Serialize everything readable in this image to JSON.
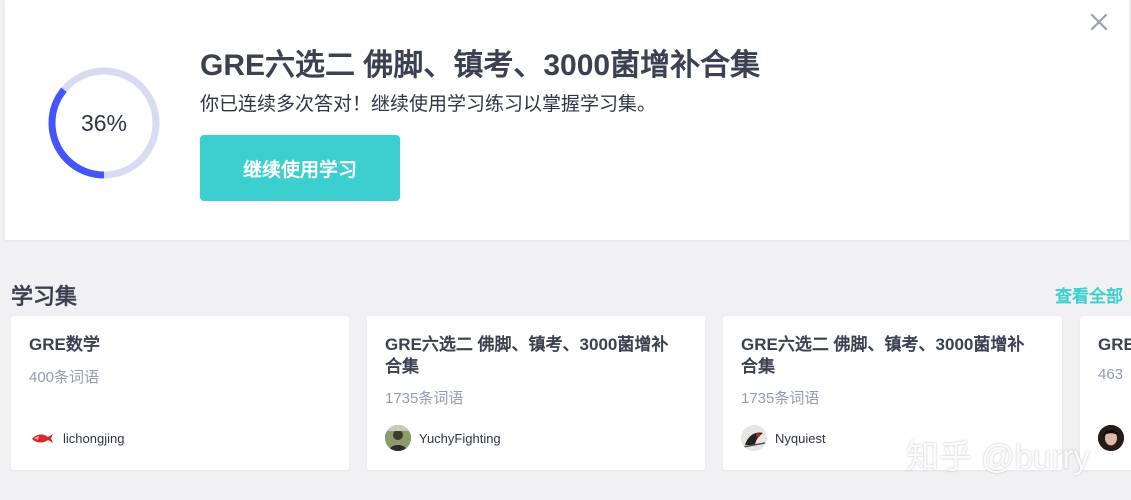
{
  "banner": {
    "progress_text": "36%",
    "progress_fraction": 0.36,
    "title": "GRE六选二 佛脚、镇考、3000菌增补合集",
    "subtitle": "你已连续多次答对！继续使用学习练习以掌握学习集。",
    "cta_label": "继续使用学习",
    "close_icon": "close-icon"
  },
  "section": {
    "title": "学习集",
    "view_all": "查看全部"
  },
  "cards": [
    {
      "title": "GRE数学",
      "count": "400条词语",
      "user": "lichongjing"
    },
    {
      "title": "GRE六选二 佛脚、镇考、3000菌增补合集",
      "count": "1735条词语",
      "user": "YuchyFighting"
    },
    {
      "title": "GRE六选二 佛脚、镇考、3000菌增补合集",
      "count": "1735条词语",
      "user": "Nyquiest"
    },
    {
      "title": "GRE",
      "count": "463",
      "user": ""
    }
  ],
  "watermark": "知乎 @burry",
  "colors": {
    "accent": "#3ccfcf",
    "progress_fill": "#4255ff",
    "progress_track": "#d9dcf0",
    "background": "#f1f1f3"
  }
}
